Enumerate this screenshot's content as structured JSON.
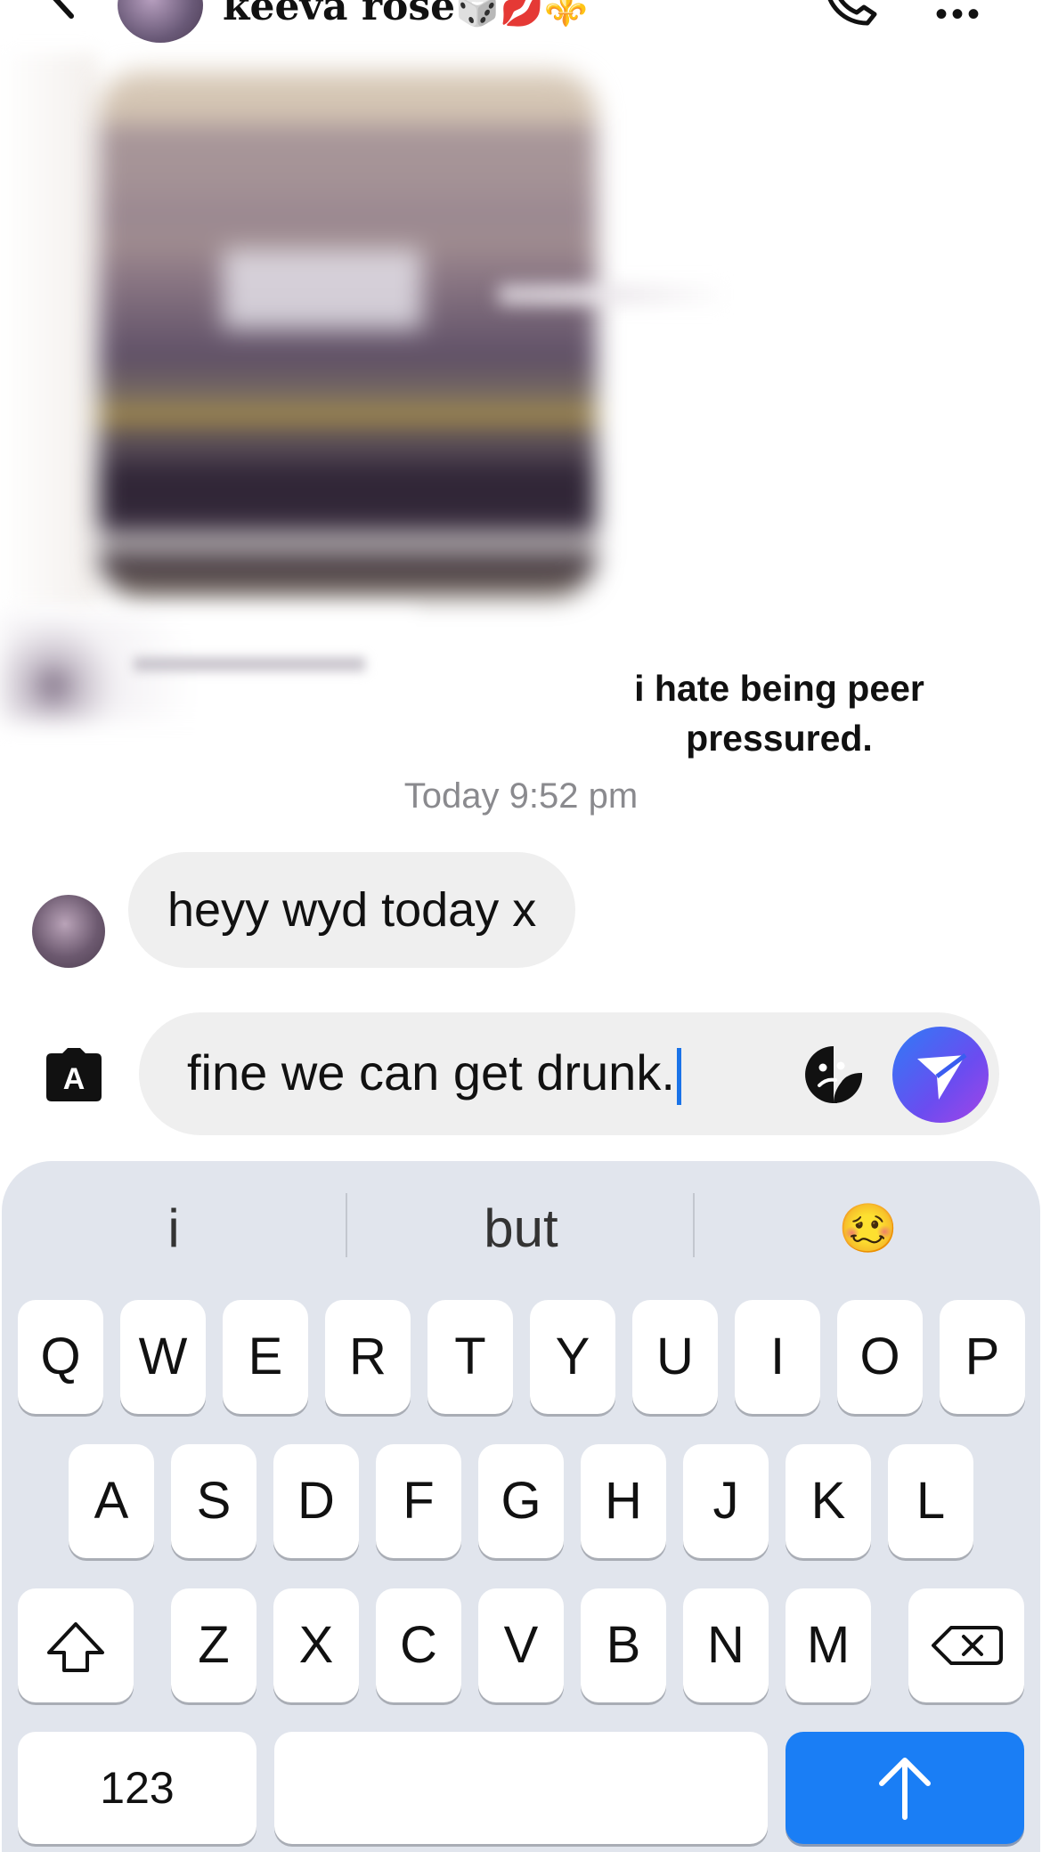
{
  "header": {
    "contact_name": "keeva rose",
    "name_emojis": "🎲💋⚜️",
    "more_label": "•••"
  },
  "conversation": {
    "outgoing_message": "i hate being peer pressured.",
    "timestamp": "Today 9:52 pm",
    "incoming_message": "heyy wyd today x"
  },
  "composer": {
    "input_value": "fine we can get drunk.",
    "keyboard_switch_letter": "A"
  },
  "keyboard": {
    "suggestions": [
      "i",
      "but",
      "🥴"
    ],
    "row1": [
      "Q",
      "W",
      "E",
      "R",
      "T",
      "Y",
      "U",
      "I",
      "O",
      "P"
    ],
    "row2": [
      "A",
      "S",
      "D",
      "F",
      "G",
      "H",
      "J",
      "K",
      "L"
    ],
    "row3": [
      "Z",
      "X",
      "C",
      "V",
      "B",
      "N",
      "M"
    ],
    "numbers_label": "123"
  },
  "colors": {
    "accent_blue": "#1a7ef5",
    "caret": "#1a73e8",
    "send_gradient_start": "#2e7cf6",
    "send_gradient_end": "#a445e6"
  }
}
